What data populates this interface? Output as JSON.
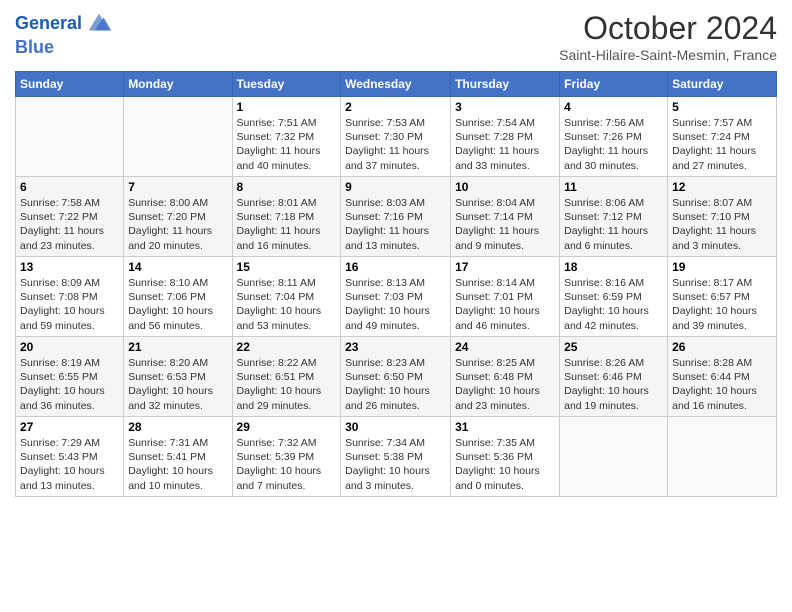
{
  "header": {
    "logo_line1": "General",
    "logo_line2": "Blue",
    "month": "October 2024",
    "location": "Saint-Hilaire-Saint-Mesmin, France"
  },
  "weekdays": [
    "Sunday",
    "Monday",
    "Tuesday",
    "Wednesday",
    "Thursday",
    "Friday",
    "Saturday"
  ],
  "weeks": [
    [
      {
        "day": "",
        "info": ""
      },
      {
        "day": "",
        "info": ""
      },
      {
        "day": "1",
        "info": "Sunrise: 7:51 AM\nSunset: 7:32 PM\nDaylight: 11 hours and 40 minutes."
      },
      {
        "day": "2",
        "info": "Sunrise: 7:53 AM\nSunset: 7:30 PM\nDaylight: 11 hours and 37 minutes."
      },
      {
        "day": "3",
        "info": "Sunrise: 7:54 AM\nSunset: 7:28 PM\nDaylight: 11 hours and 33 minutes."
      },
      {
        "day": "4",
        "info": "Sunrise: 7:56 AM\nSunset: 7:26 PM\nDaylight: 11 hours and 30 minutes."
      },
      {
        "day": "5",
        "info": "Sunrise: 7:57 AM\nSunset: 7:24 PM\nDaylight: 11 hours and 27 minutes."
      }
    ],
    [
      {
        "day": "6",
        "info": "Sunrise: 7:58 AM\nSunset: 7:22 PM\nDaylight: 11 hours and 23 minutes."
      },
      {
        "day": "7",
        "info": "Sunrise: 8:00 AM\nSunset: 7:20 PM\nDaylight: 11 hours and 20 minutes."
      },
      {
        "day": "8",
        "info": "Sunrise: 8:01 AM\nSunset: 7:18 PM\nDaylight: 11 hours and 16 minutes."
      },
      {
        "day": "9",
        "info": "Sunrise: 8:03 AM\nSunset: 7:16 PM\nDaylight: 11 hours and 13 minutes."
      },
      {
        "day": "10",
        "info": "Sunrise: 8:04 AM\nSunset: 7:14 PM\nDaylight: 11 hours and 9 minutes."
      },
      {
        "day": "11",
        "info": "Sunrise: 8:06 AM\nSunset: 7:12 PM\nDaylight: 11 hours and 6 minutes."
      },
      {
        "day": "12",
        "info": "Sunrise: 8:07 AM\nSunset: 7:10 PM\nDaylight: 11 hours and 3 minutes."
      }
    ],
    [
      {
        "day": "13",
        "info": "Sunrise: 8:09 AM\nSunset: 7:08 PM\nDaylight: 10 hours and 59 minutes."
      },
      {
        "day": "14",
        "info": "Sunrise: 8:10 AM\nSunset: 7:06 PM\nDaylight: 10 hours and 56 minutes."
      },
      {
        "day": "15",
        "info": "Sunrise: 8:11 AM\nSunset: 7:04 PM\nDaylight: 10 hours and 53 minutes."
      },
      {
        "day": "16",
        "info": "Sunrise: 8:13 AM\nSunset: 7:03 PM\nDaylight: 10 hours and 49 minutes."
      },
      {
        "day": "17",
        "info": "Sunrise: 8:14 AM\nSunset: 7:01 PM\nDaylight: 10 hours and 46 minutes."
      },
      {
        "day": "18",
        "info": "Sunrise: 8:16 AM\nSunset: 6:59 PM\nDaylight: 10 hours and 42 minutes."
      },
      {
        "day": "19",
        "info": "Sunrise: 8:17 AM\nSunset: 6:57 PM\nDaylight: 10 hours and 39 minutes."
      }
    ],
    [
      {
        "day": "20",
        "info": "Sunrise: 8:19 AM\nSunset: 6:55 PM\nDaylight: 10 hours and 36 minutes."
      },
      {
        "day": "21",
        "info": "Sunrise: 8:20 AM\nSunset: 6:53 PM\nDaylight: 10 hours and 32 minutes."
      },
      {
        "day": "22",
        "info": "Sunrise: 8:22 AM\nSunset: 6:51 PM\nDaylight: 10 hours and 29 minutes."
      },
      {
        "day": "23",
        "info": "Sunrise: 8:23 AM\nSunset: 6:50 PM\nDaylight: 10 hours and 26 minutes."
      },
      {
        "day": "24",
        "info": "Sunrise: 8:25 AM\nSunset: 6:48 PM\nDaylight: 10 hours and 23 minutes."
      },
      {
        "day": "25",
        "info": "Sunrise: 8:26 AM\nSunset: 6:46 PM\nDaylight: 10 hours and 19 minutes."
      },
      {
        "day": "26",
        "info": "Sunrise: 8:28 AM\nSunset: 6:44 PM\nDaylight: 10 hours and 16 minutes."
      }
    ],
    [
      {
        "day": "27",
        "info": "Sunrise: 7:29 AM\nSunset: 5:43 PM\nDaylight: 10 hours and 13 minutes."
      },
      {
        "day": "28",
        "info": "Sunrise: 7:31 AM\nSunset: 5:41 PM\nDaylight: 10 hours and 10 minutes."
      },
      {
        "day": "29",
        "info": "Sunrise: 7:32 AM\nSunset: 5:39 PM\nDaylight: 10 hours and 7 minutes."
      },
      {
        "day": "30",
        "info": "Sunrise: 7:34 AM\nSunset: 5:38 PM\nDaylight: 10 hours and 3 minutes."
      },
      {
        "day": "31",
        "info": "Sunrise: 7:35 AM\nSunset: 5:36 PM\nDaylight: 10 hours and 0 minutes."
      },
      {
        "day": "",
        "info": ""
      },
      {
        "day": "",
        "info": ""
      }
    ]
  ]
}
